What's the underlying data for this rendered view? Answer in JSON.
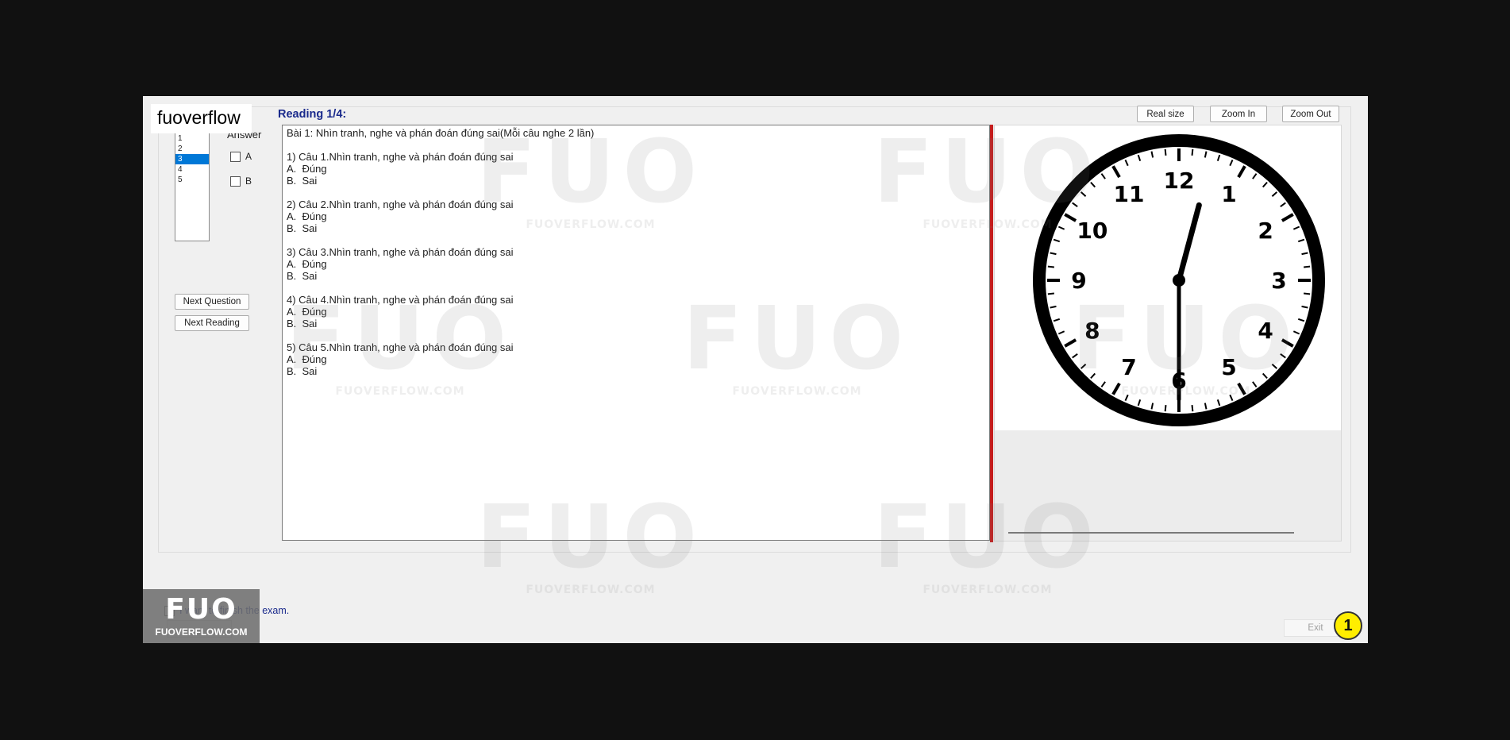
{
  "brand_tag": "fuoverflow",
  "sidebar": {
    "answer_label": "Answer",
    "questions": [
      "1",
      "2",
      "3",
      "4",
      "5"
    ],
    "selected_question": "3",
    "options": [
      "A",
      "B"
    ],
    "next_question_label": "Next Question",
    "next_reading_label": "Next Reading"
  },
  "reading": {
    "title": "Reading 1/4:",
    "text": "Bài 1: Nhìn tranh, nghe và phán đoán đúng sai(Mỗi câu nghe 2 lần)\n\n1) Câu 1.Nhìn tranh, nghe và phán đoán đúng sai\nA.  Đúng\nB.  Sai\n\n2) Câu 2.Nhìn tranh, nghe và phán đoán đúng sai\nA.  Đúng\nB.  Sai\n\n3) Câu 3.Nhìn tranh, nghe và phán đoán đúng sai\nA.  Đúng\nB.  Sai\n\n4) Câu 4.Nhìn tranh, nghe và phán đoán đúng sai\nA.  Đúng\nB.  Sai\n\n5) Câu 5.Nhìn tranh, nghe và phán đoán đúng sai\nA.  Đúng\nB.  Sai"
  },
  "toolbar": {
    "real_size_label": "Real size",
    "zoom_in_label": "Zoom In",
    "zoom_out_label": "Zoom Out"
  },
  "clock": {
    "numbers": [
      "12",
      "1",
      "2",
      "3",
      "4",
      "5",
      "6",
      "7",
      "8",
      "9",
      "10",
      "11"
    ],
    "hour": 12,
    "minute": 30
  },
  "footer": {
    "finish_text": "I want to finish the exam.",
    "exit_label": "Exit",
    "badge_number": "1"
  },
  "watermark": {
    "logo_text": "FUO",
    "site_text": "FUOVERFLOW.COM"
  },
  "colors": {
    "accent": "#1a2a8c",
    "selection": "#0078d7",
    "divider": "#c41d1d",
    "badge": "#ffee00"
  }
}
